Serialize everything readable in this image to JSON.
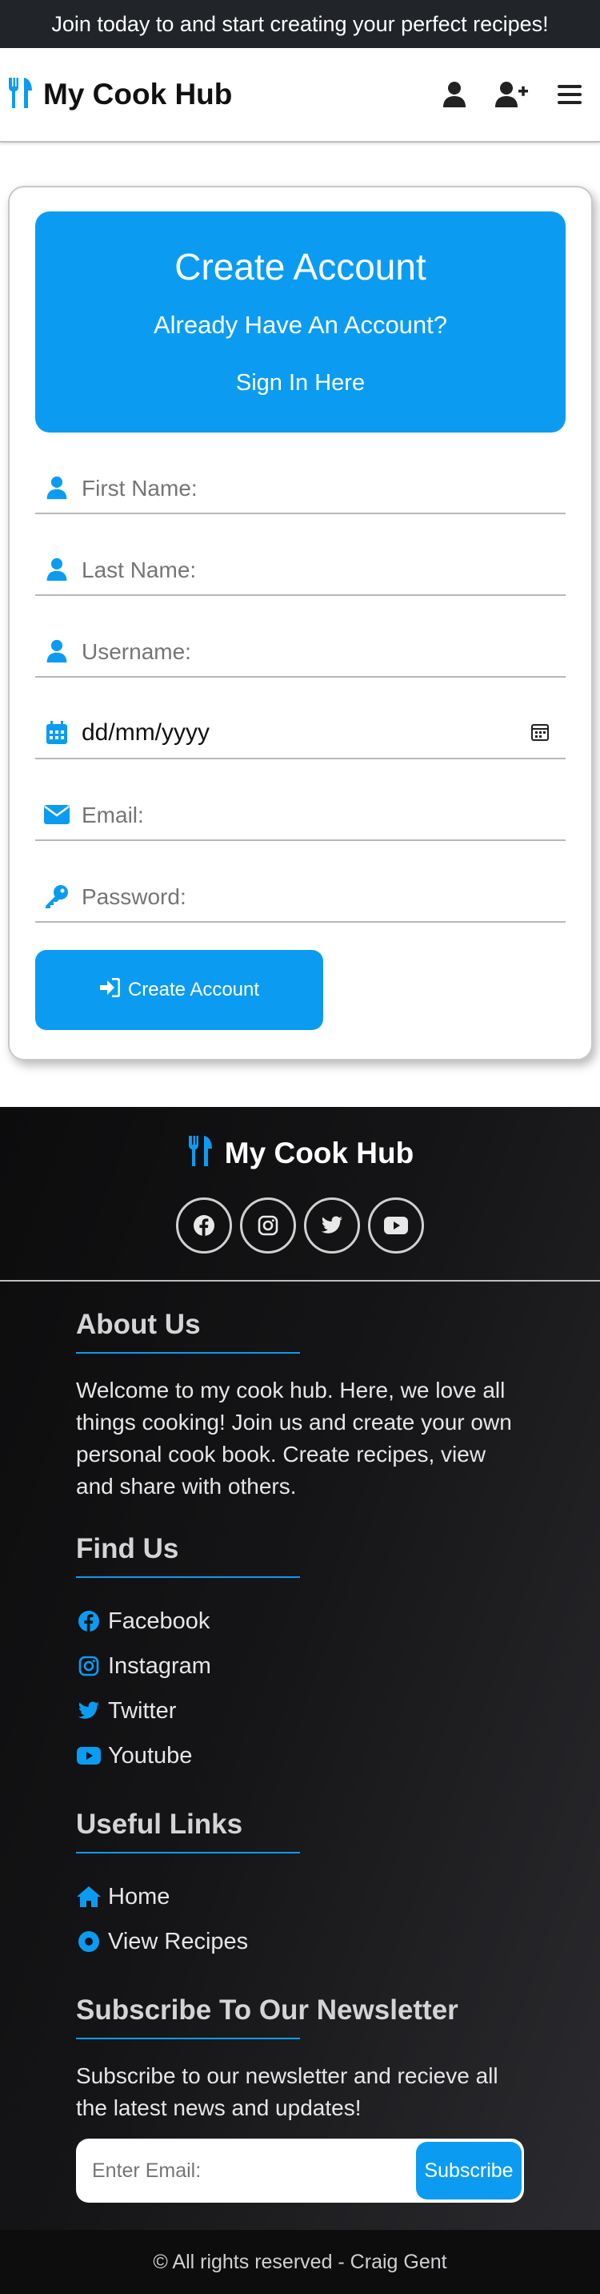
{
  "banner": {
    "text": "Join today to and start creating your perfect recipes!"
  },
  "navbar": {
    "brand": "My Cook Hub",
    "icons": [
      "user-icon",
      "user-plus-icon",
      "menu-icon"
    ]
  },
  "form": {
    "header_title": "Create Account",
    "header_subtitle": "Already Have An Account?",
    "signin_link": "Sign In Here",
    "first_name_placeholder": "First Name:",
    "last_name_placeholder": "Last Name:",
    "username_placeholder": "Username:",
    "dob_value": "dd/mm/yyyy",
    "email_placeholder": "Email:",
    "password_placeholder": "Password:",
    "submit_label": "Create Account"
  },
  "footer": {
    "brand": "My Cook Hub",
    "socials": [
      "facebook-icon",
      "instagram-icon",
      "twitter-icon",
      "youtube-icon"
    ],
    "about_title": "About Us",
    "about_text": "Welcome to my cook hub. Here, we love all things cooking! Join us and create your own personal cook book. Create recipes, view and share with others.",
    "find_title": "Find Us",
    "find_links": [
      "Facebook",
      "Instagram",
      "Twitter",
      "Youtube"
    ],
    "links_title": "Useful Links",
    "useful_links": [
      "Home",
      "View Recipes"
    ],
    "newsletter_title": "Subscribe To Our Newsletter",
    "newsletter_text": "Subscribe to our newsletter and recieve all the latest news and updates!",
    "newsletter_placeholder": "Enter Email:",
    "subscribe_label": "Subscribe",
    "copyright": "© All rights reserved - Craig Gent"
  },
  "colors": {
    "accent": "#0b9cf2",
    "dark": "#212529"
  }
}
